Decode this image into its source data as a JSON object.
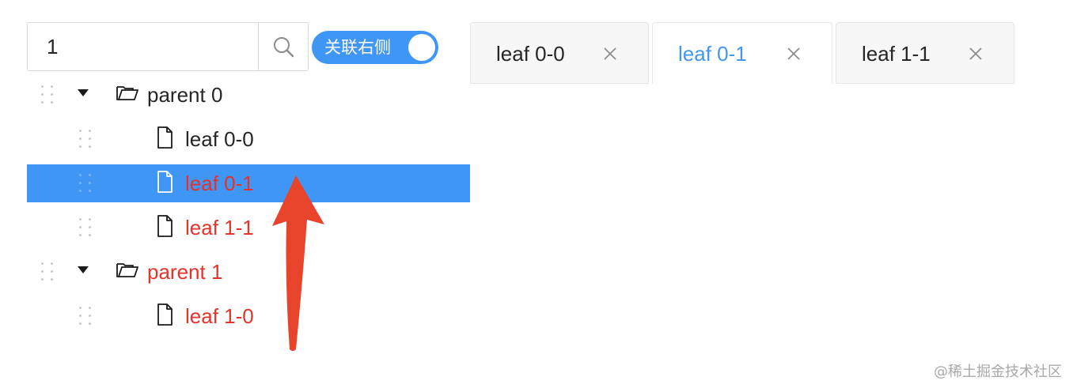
{
  "search": {
    "value": "1",
    "placeholder": ""
  },
  "toggle": {
    "label": "关联右侧",
    "on": true
  },
  "tree": {
    "nodes": [
      {
        "label": "parent 0",
        "type": "folder",
        "level": 0,
        "expanded": true,
        "highlight": false,
        "selected": false
      },
      {
        "label": "leaf 0-0",
        "type": "file",
        "level": 1,
        "highlight": false,
        "selected": false
      },
      {
        "label": "leaf 0-1",
        "type": "file",
        "level": 1,
        "highlight": true,
        "selected": true
      },
      {
        "label": "leaf 1-1",
        "type": "file",
        "level": 1,
        "highlight": true,
        "selected": false
      },
      {
        "label": "parent 1",
        "type": "folder",
        "level": 0,
        "expanded": true,
        "highlight": true,
        "selected": false
      },
      {
        "label": "leaf 1-0",
        "type": "file",
        "level": 1,
        "highlight": true,
        "selected": false
      }
    ]
  },
  "tabs": [
    {
      "label": "leaf 0-0",
      "active": false,
      "close": "×"
    },
    {
      "label": "leaf 0-1",
      "active": true,
      "close": "×"
    },
    {
      "label": "leaf 1-1",
      "active": false,
      "close": "×"
    }
  ],
  "watermark": "@稀土掘金技术社区",
  "colors": {
    "accent": "#4096f5",
    "highlight_text": "#e6332a",
    "annotation_arrow": "#e8432b"
  },
  "icons": {
    "search": "search-icon",
    "folder": "folder-open-icon",
    "file": "file-icon",
    "caret": "caret-down-icon",
    "drag": "drag-handle-icon",
    "close": "close-icon"
  }
}
